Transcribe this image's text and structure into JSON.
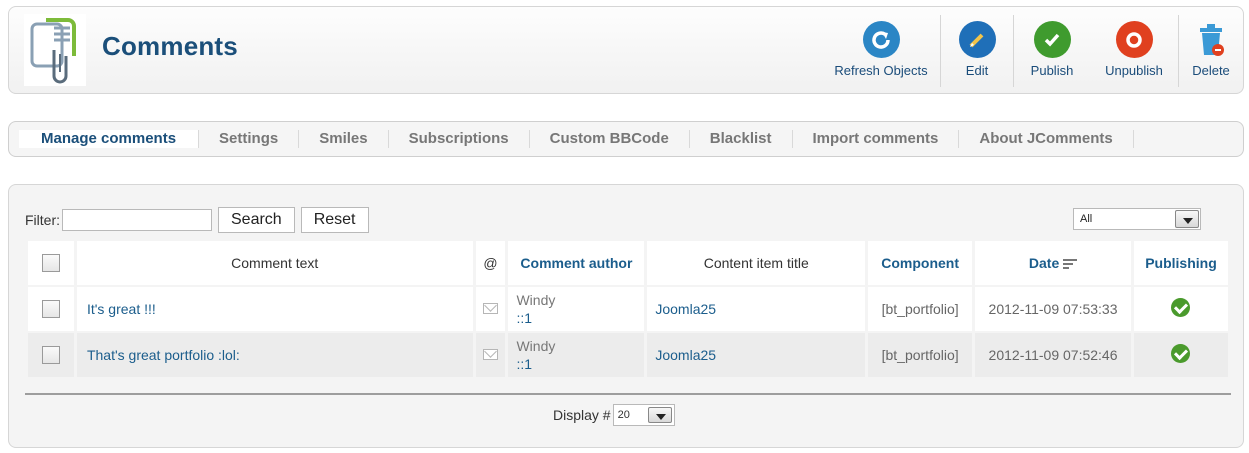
{
  "header": {
    "title": "Comments",
    "toolbar": [
      {
        "label": "Refresh Objects",
        "icon": "refresh-icon",
        "color": "#2b86c5"
      },
      {
        "label": "Edit",
        "icon": "edit-icon",
        "color": "#1f6fb8"
      },
      {
        "label": "Publish",
        "icon": "publish-icon",
        "color": "#3f9b2e"
      },
      {
        "label": "Unpublish",
        "icon": "unpublish-icon",
        "color": "#e0401f"
      },
      {
        "label": "Delete",
        "icon": "trash-icon",
        "color": "#3b9ad6"
      }
    ]
  },
  "tabs": [
    {
      "label": "Manage comments",
      "active": true
    },
    {
      "label": "Settings"
    },
    {
      "label": "Smiles"
    },
    {
      "label": "Subscriptions"
    },
    {
      "label": "Custom BBCode"
    },
    {
      "label": "Blacklist"
    },
    {
      "label": "Import comments"
    },
    {
      "label": "About JComments"
    }
  ],
  "filter": {
    "label": "Filter:",
    "value": "",
    "search_label": "Search",
    "reset_label": "Reset",
    "state_select": "All"
  },
  "table": {
    "columns": {
      "comment_text": "Comment text",
      "email": "@",
      "author": "Comment author",
      "content_title": "Content item title",
      "component": "Component",
      "date": "Date",
      "publishing": "Publishing"
    },
    "rows": [
      {
        "comment": "It's great !!!",
        "author_name": "Windy",
        "author_ip": "::1",
        "content": "Joomla25",
        "component": "[bt_portfolio]",
        "date": "2012-11-09 07:53:33",
        "published": true
      },
      {
        "comment": "That's great portfolio :lol:",
        "author_name": "Windy",
        "author_ip": "::1",
        "content": "Joomla25",
        "component": "[bt_portfolio]",
        "date": "2012-11-09 07:52:46",
        "published": true
      }
    ]
  },
  "footer": {
    "display_label": "Display #",
    "display_value": "20"
  }
}
